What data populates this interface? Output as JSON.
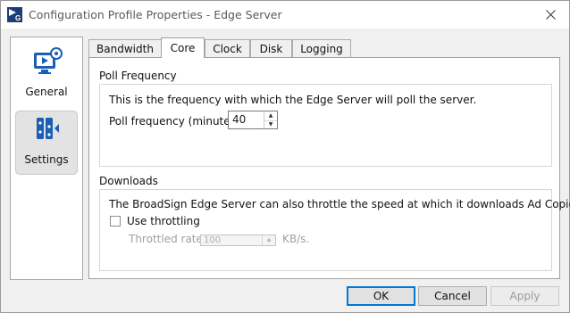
{
  "window": {
    "title": "Configuration Profile Properties - Edge Server",
    "app_icon": "broadsign-app-icon",
    "close_icon": "close-icon"
  },
  "sidebar": {
    "items": [
      {
        "label": "General",
        "icon": "monitor-gear-icon",
        "selected": false
      },
      {
        "label": "Settings",
        "icon": "settings-panel-icon",
        "selected": true
      }
    ]
  },
  "tabs": [
    {
      "label": "Bandwidth",
      "active": false
    },
    {
      "label": "Core",
      "active": true
    },
    {
      "label": "Clock",
      "active": false
    },
    {
      "label": "Disk",
      "active": false
    },
    {
      "label": "Logging",
      "active": false
    }
  ],
  "poll": {
    "section_label": "Poll Frequency",
    "description": "This is the frequency with which the Edge Server will poll the server.",
    "field_label": "Poll frequency (minutes):",
    "value": "40"
  },
  "downloads": {
    "section_label": "Downloads",
    "description": "The BroadSign Edge Server can also throttle the speed at which it downloads Ad Copies.",
    "throttling_label": "Use throttling",
    "throttling_checked": false,
    "rate_label": "Throttled rate:",
    "rate_value": "100",
    "rate_unit": "KB/s."
  },
  "buttons": {
    "ok": "OK",
    "cancel": "Cancel",
    "apply": "Apply"
  },
  "colors": {
    "accent": "#0078d7",
    "icon_blue": "#1a5fb4"
  }
}
